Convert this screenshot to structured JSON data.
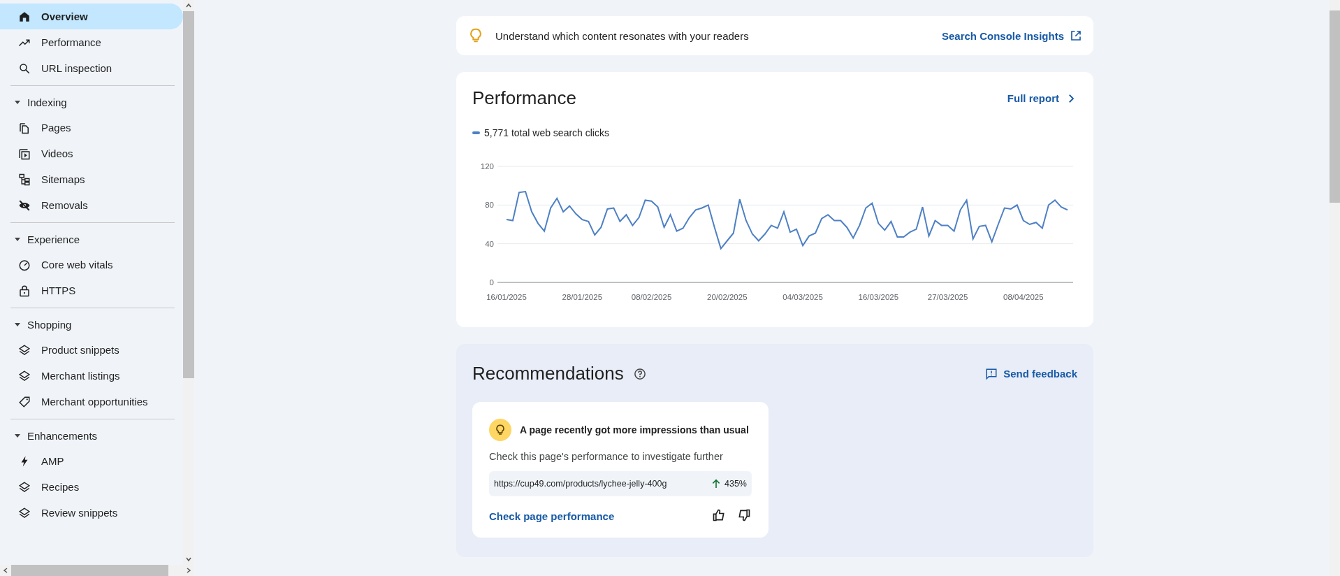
{
  "sidebar": {
    "groups": [
      {
        "items": [
          {
            "label": "Overview",
            "selected": true
          },
          {
            "label": "Performance",
            "selected": false
          },
          {
            "label": "URL inspection",
            "selected": false
          }
        ]
      },
      {
        "title": "Indexing",
        "expanded": true,
        "items": [
          {
            "label": "Pages",
            "selected": false
          },
          {
            "label": "Videos",
            "selected": false
          },
          {
            "label": "Sitemaps",
            "selected": false
          },
          {
            "label": "Removals",
            "selected": false
          }
        ]
      },
      {
        "title": "Experience",
        "expanded": true,
        "items": [
          {
            "label": "Core web vitals",
            "selected": false
          },
          {
            "label": "HTTPS",
            "selected": false
          }
        ]
      },
      {
        "title": "Shopping",
        "expanded": true,
        "items": [
          {
            "label": "Product snippets",
            "selected": false
          },
          {
            "label": "Merchant listings",
            "selected": false
          },
          {
            "label": "Merchant opportunities",
            "selected": false
          }
        ]
      },
      {
        "title": "Enhancements",
        "expanded": true,
        "items": [
          {
            "label": "AMP",
            "selected": false
          },
          {
            "label": "Recipes",
            "selected": false
          },
          {
            "label": "Review snippets",
            "selected": false
          }
        ]
      }
    ]
  },
  "insight_banner": {
    "text": "Understand which content resonates with your readers",
    "link": "Search Console Insights"
  },
  "performance": {
    "title": "Performance",
    "link": "Full report",
    "chart_data": {
      "type": "line",
      "categories": [
        "16/01/2025",
        null,
        null,
        null,
        null,
        null,
        null,
        null,
        null,
        null,
        null,
        null,
        "28/01/2025",
        null,
        null,
        null,
        null,
        null,
        null,
        null,
        null,
        null,
        null,
        "08/02/2025",
        null,
        null,
        null,
        null,
        null,
        null,
        null,
        null,
        null,
        null,
        null,
        "20/02/2025",
        null,
        null,
        null,
        null,
        null,
        null,
        null,
        null,
        null,
        null,
        null,
        "04/03/2025",
        null,
        null,
        null,
        null,
        null,
        null,
        null,
        null,
        null,
        null,
        null,
        "16/03/2025",
        null,
        null,
        null,
        null,
        null,
        null,
        null,
        null,
        null,
        null,
        "27/03/2025",
        null,
        null,
        null,
        null,
        null,
        null,
        null,
        null,
        null,
        null,
        null,
        "08/04/2025",
        null,
        null,
        null,
        null,
        null,
        null,
        null
      ],
      "series": [
        {
          "name": "5,771 total web search clicks",
          "color": "#4e80c4",
          "values": [
            65,
            64,
            93,
            94,
            73,
            61,
            53,
            77,
            87,
            73,
            79,
            71,
            65,
            63,
            49,
            57,
            76,
            77,
            63,
            70,
            59,
            67,
            85,
            84,
            78,
            57,
            70,
            53,
            56,
            67,
            75,
            77,
            80,
            57,
            35,
            43,
            51,
            86,
            64,
            50,
            43,
            50,
            59,
            56,
            73,
            52,
            55,
            38,
            48,
            51,
            66,
            70,
            64,
            64,
            57,
            46,
            59,
            77,
            82,
            61,
            54,
            63,
            47,
            47,
            52,
            55,
            78,
            48,
            64,
            59,
            59,
            53,
            75,
            85,
            45,
            58,
            59,
            42,
            60,
            77,
            76,
            80,
            64,
            60,
            62,
            56,
            80,
            85,
            78,
            75
          ]
        }
      ],
      "ylim": [
        0,
        120
      ],
      "yticks": [
        0,
        40,
        80,
        120
      ]
    }
  },
  "recommendations": {
    "title": "Recommendations",
    "feedback": "Send feedback",
    "cards": [
      {
        "title": "A page recently got more impressions than usual",
        "description": "Check this page's performance to investigate further",
        "url": "https://cup49.com/products/lychee-jelly-400g",
        "change": "435%",
        "action": "Check page performance"
      }
    ]
  }
}
